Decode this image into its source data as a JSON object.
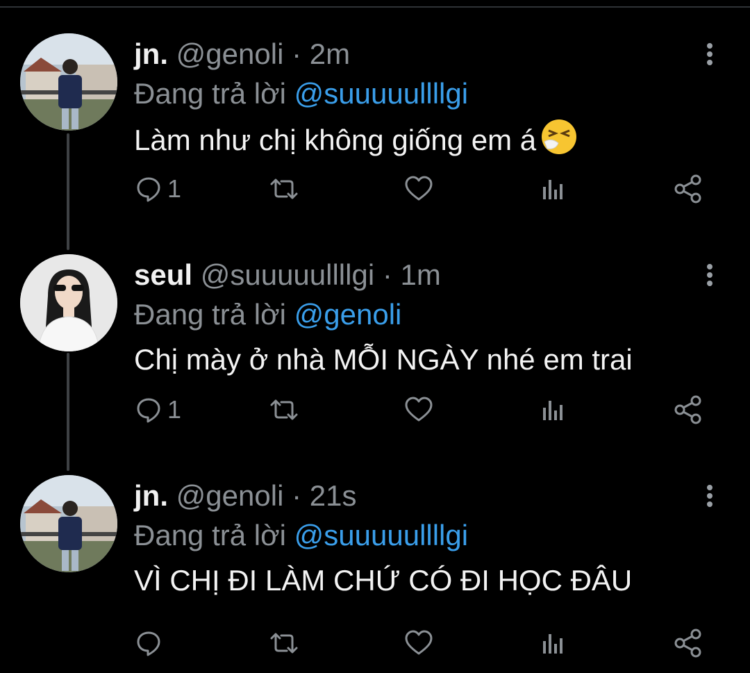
{
  "colors": {
    "background": "#000000",
    "name": "#f1f1f1",
    "secondary": "#8b9095",
    "mention": "#3a9eea",
    "thread_line": "#3e4144"
  },
  "tweets": [
    {
      "name": "jn.",
      "handle": "@genoli",
      "dot": "·",
      "time": "2m",
      "reply_prefix": "Đang trả lời",
      "reply_to": "@suuuuullllgi",
      "text": "Làm như chị không giống em á",
      "emoji": "sneezing-face-emoji",
      "reply_count": "1",
      "avatar": "avatar-jn"
    },
    {
      "name": "seul",
      "handle": "@suuuuullllgi",
      "dot": "·",
      "time": "1m",
      "reply_prefix": "Đang trả lời",
      "reply_to": "@genoli",
      "text": "Chị mày ở nhà MỖI NGÀY nhé em trai",
      "reply_count": "1",
      "avatar": "avatar-seul"
    },
    {
      "name": "jn.",
      "handle": "@genoli",
      "dot": "·",
      "time": "21s",
      "reply_prefix": "Đang trả lời",
      "reply_to": "@suuuuullllgi",
      "text": "VÌ CHỊ ĐI LÀM CHỨ CÓ ĐI HỌC ĐÂU",
      "reply_count": "",
      "avatar": "avatar-jn"
    }
  ],
  "icons": [
    "reply-icon",
    "retweet-icon",
    "like-icon",
    "analytics-icon",
    "share-icon",
    "more-icon"
  ]
}
